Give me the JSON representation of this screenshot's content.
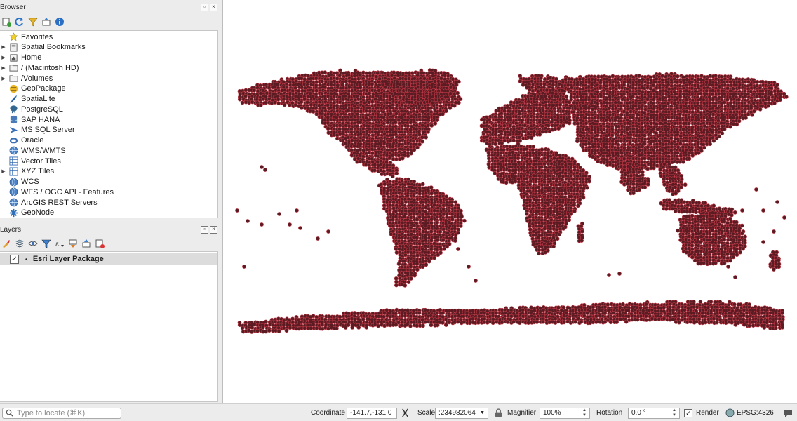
{
  "browser": {
    "title": "Browser",
    "items": [
      {
        "label": "Favorites",
        "icon": "star-icon",
        "expand": false
      },
      {
        "label": "Spatial Bookmarks",
        "icon": "bookmark-icon",
        "expand": true
      },
      {
        "label": "Home",
        "icon": "home-icon",
        "expand": true
      },
      {
        "label": "/ (Macintosh HD)",
        "icon": "folder-icon",
        "expand": true
      },
      {
        "label": "/Volumes",
        "icon": "folder-icon",
        "expand": true
      },
      {
        "label": "GeoPackage",
        "icon": "geopackage-icon",
        "expand": false
      },
      {
        "label": "SpatiaLite",
        "icon": "feather-icon",
        "expand": false
      },
      {
        "label": "PostgreSQL",
        "icon": "elephant-icon",
        "expand": false
      },
      {
        "label": "SAP HANA",
        "icon": "database-icon",
        "expand": false
      },
      {
        "label": "MS SQL Server",
        "icon": "mssql-icon",
        "expand": false
      },
      {
        "label": "Oracle",
        "icon": "oracle-icon",
        "expand": false
      },
      {
        "label": "WMS/WMTS",
        "icon": "globe-icon",
        "expand": false
      },
      {
        "label": "Vector Tiles",
        "icon": "grid-icon",
        "expand": false
      },
      {
        "label": "XYZ Tiles",
        "icon": "grid-icon",
        "expand": true
      },
      {
        "label": "WCS",
        "icon": "globe-icon",
        "expand": false
      },
      {
        "label": "WFS / OGC API - Features",
        "icon": "globe-icon",
        "expand": false
      },
      {
        "label": "ArcGIS REST Servers",
        "icon": "globe-icon",
        "expand": false
      },
      {
        "label": "GeoNode",
        "icon": "geonode-icon",
        "expand": false
      }
    ]
  },
  "layers": {
    "title": "Layers",
    "items": [
      {
        "name": "Esri Layer Package",
        "checked": true
      }
    ]
  },
  "map": {
    "point_color": "#5a1c22",
    "point_outline": "#c23a48",
    "background": "#ffffff"
  },
  "status": {
    "locate_placeholder": "Type to locate (⌘K)",
    "coordinate_label": "Coordinate",
    "coordinate_value": "-141.7,-131.0",
    "scale_label": "Scale",
    "scale_value": ":234982064",
    "magnifier_label": "Magnifier",
    "magnifier_value": "100%",
    "rotation_label": "Rotation",
    "rotation_value": "0.0 °",
    "render_label": "Render",
    "render_checked": true,
    "crs_value": "EPSG:4326"
  }
}
